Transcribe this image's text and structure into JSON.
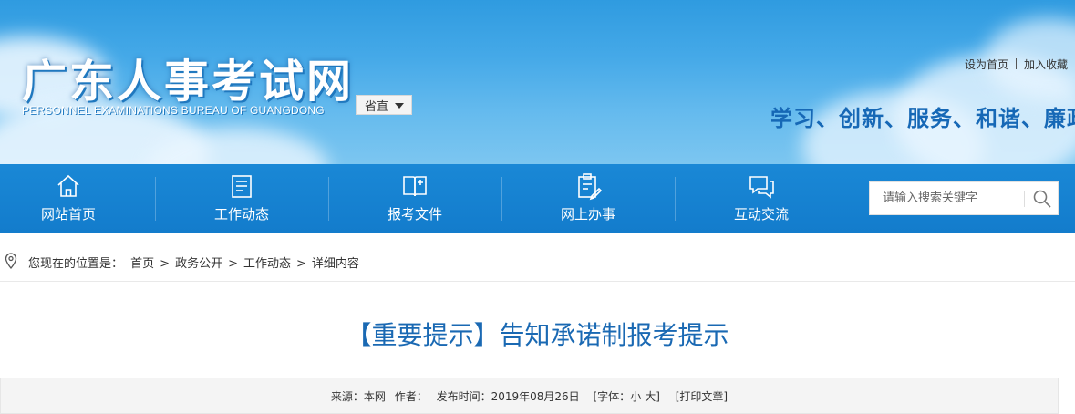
{
  "header": {
    "site_title": "广东人事考试网",
    "site_subtitle": "PERSONNEL EXAMINATIONS BUREAU OF GUANGDONG",
    "region_selector": "省直",
    "top_links": {
      "set_homepage": "设为首页",
      "add_favorite": "加入收藏"
    },
    "slogan": "学习、创新、服务、和谐、廉政"
  },
  "nav": {
    "items": [
      {
        "label": "网站首页",
        "icon": "home-icon"
      },
      {
        "label": "工作动态",
        "icon": "document-list-icon"
      },
      {
        "label": "报考文件",
        "icon": "open-book-icon"
      },
      {
        "label": "网上办事",
        "icon": "clipboard-edit-icon"
      },
      {
        "label": "互动交流",
        "icon": "chat-bubbles-icon"
      }
    ],
    "search": {
      "placeholder": "请输入搜索关键字",
      "value": ""
    }
  },
  "breadcrumb": {
    "prefix": "您现在的位置是：",
    "items": [
      "首页",
      "政务公开",
      "工作动态",
      "详细内容"
    ],
    "separator": ">"
  },
  "article": {
    "title": "【重要提示】告知承诺制报考提示",
    "meta": {
      "source": "来源：本网",
      "author": "作者：",
      "published": "发布时间：2019年08月26日",
      "font_size_open": "[字体：",
      "font_small": "小",
      "font_large": "大",
      "font_size_close": "]",
      "print": "[打印文章]"
    }
  },
  "colors": {
    "nav_bar": "#1682d2",
    "title_blue": "#1a69b3",
    "slogan_blue": "#1668b6",
    "sky_top": "#2f9be0"
  }
}
